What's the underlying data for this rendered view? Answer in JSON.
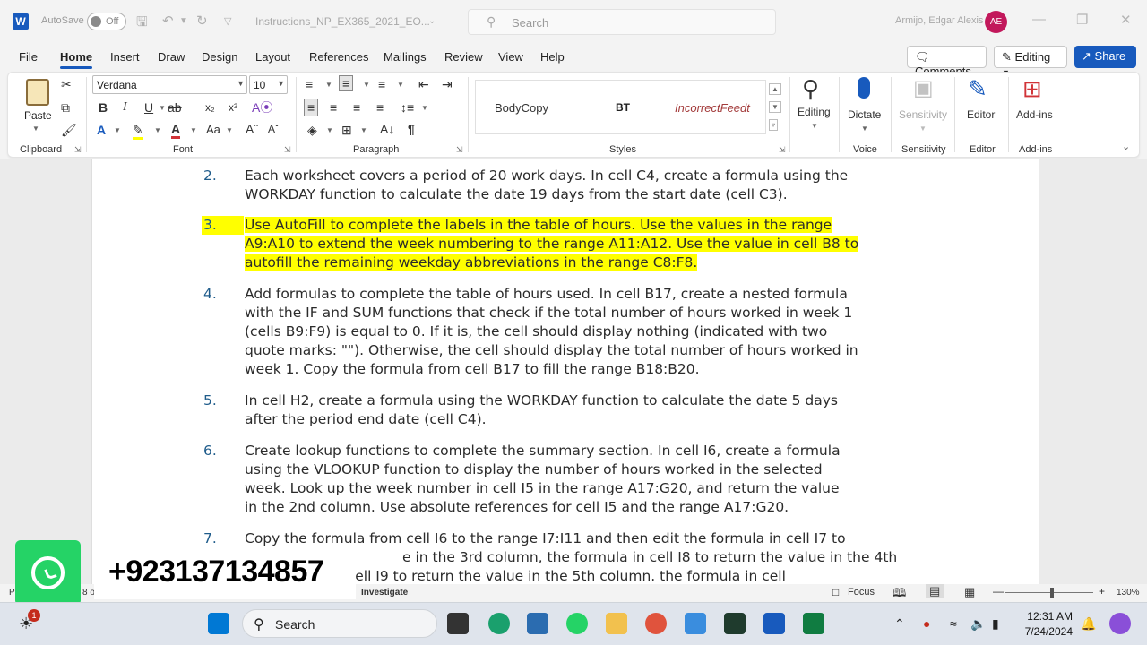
{
  "titlebar": {
    "autosave_label": "AutoSave",
    "autosave_state": "Off",
    "doc_title": "Instructions_NP_EX365_2021_EO...",
    "search_placeholder": "Search",
    "user_name": "Armijo, Edgar Alexis",
    "user_initials": "AE"
  },
  "menu": {
    "tabs": [
      "File",
      "Home",
      "Insert",
      "Draw",
      "Design",
      "Layout",
      "References",
      "Mailings",
      "Review",
      "View",
      "Help"
    ],
    "active": "Home",
    "comments_label": "Comments",
    "editing_label": "Editing",
    "share_label": "Share"
  },
  "ribbon": {
    "clipboard": {
      "paste_label": "Paste",
      "group_label": "Clipboard"
    },
    "font": {
      "name": "Verdana",
      "size": "10",
      "group_label": "Font"
    },
    "paragraph": {
      "group_label": "Paragraph"
    },
    "styles": {
      "items": [
        "BodyCopy",
        "BT",
        "IncorrectFeedt"
      ],
      "group_label": "Styles"
    },
    "editing": {
      "label": "Editing"
    },
    "voice": {
      "label": "Dictate",
      "group_label": "Voice"
    },
    "sensitivity": {
      "label": "Sensitivity",
      "group_label": "Sensitivity"
    },
    "editor": {
      "label": "Editor",
      "group_label": "Editor"
    },
    "addins": {
      "label": "Add-ins",
      "group_label": "Add-ins"
    }
  },
  "document": {
    "items": [
      {
        "num": "2.",
        "lines": [
          "Each worksheet covers a period of 20 work days. In cell C4, create a formula using the",
          "WORKDAY function to calculate the date 19 days from the start date (cell C3)."
        ]
      },
      {
        "num": "3.",
        "lines": [
          "Use AutoFill to complete the labels in the table of hours. Use the values in the range",
          "A9:A10 to extend the week numbering to the range A11:A12. Use the value in cell B8 to",
          "autofill the remaining weekday abbreviations in the range C8:F8."
        ]
      },
      {
        "num": "4.",
        "lines": [
          "Add formulas to complete the table of hours used. In cell B17, create a nested formula",
          "with the IF and SUM functions that check if the total number of hours worked in week 1",
          "(cells B9:F9) is equal to 0. If it is, the cell should display nothing (indicated with two",
          "quote marks: \"\"). Otherwise, the cell should display the total number of hours worked in",
          "week 1. Copy the formula from cell B17 to fill the range B18:B20."
        ]
      },
      {
        "num": "5.",
        "lines": [
          "In cell H2, create a formula using the WORKDAY function to calculate the date 5 days",
          "after the period end date (cell C4)."
        ]
      },
      {
        "num": "6.",
        "lines": [
          "Create lookup functions to complete the summary section. In cell I6, create a formula",
          "using the VLOOKUP function to display the number of hours worked in the selected",
          "week. Look up the week number in cell I5 in the range A17:G20, and return the value",
          "in the 2nd column. Use absolute references for cell I5 and the range A17:G20."
        ]
      },
      {
        "num": "7.",
        "lines": [
          "Copy the formula from cell I6 to the range I7:I11 and then edit the formula in cell I7 to",
          "e in the 3rd column, the formula in cell I8 to return the value in the 4th",
          "mula in cell I9 to return the value in the 5th column. the formula in cell"
        ]
      }
    ]
  },
  "statusbar": {
    "page_prefix": "P",
    "page_frag": "8 of",
    "investigate": "Investigate",
    "focus_label": "Focus",
    "zoom": "130%"
  },
  "overlay": {
    "phone": "+923137134857"
  },
  "taskbar": {
    "search_placeholder": "Search",
    "time": "12:31 AM",
    "date": "7/24/2024",
    "notification_count": "1"
  },
  "colors": {
    "accent": "#185abd",
    "highlight": "#ffff00",
    "whatsapp": "#25d366",
    "number": "#1f5c8b"
  }
}
